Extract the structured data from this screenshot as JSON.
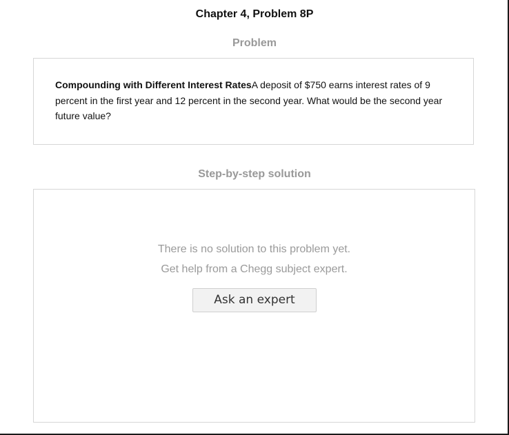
{
  "header": {
    "chapter_title": "Chapter 4, Problem 8P"
  },
  "problem": {
    "heading": "Problem",
    "title": "Compounding with Different Interest Rates",
    "text": "A deposit of $750 earns interest rates of 9 percent in the first year and 12 percent in the second year.  What would be the second year future value?"
  },
  "solution": {
    "heading": "Step-by-step solution",
    "empty_line1": "There is no solution to this problem yet.",
    "empty_line2": "Get help from a Chegg subject expert.",
    "ask_button_label": "Ask an expert"
  }
}
